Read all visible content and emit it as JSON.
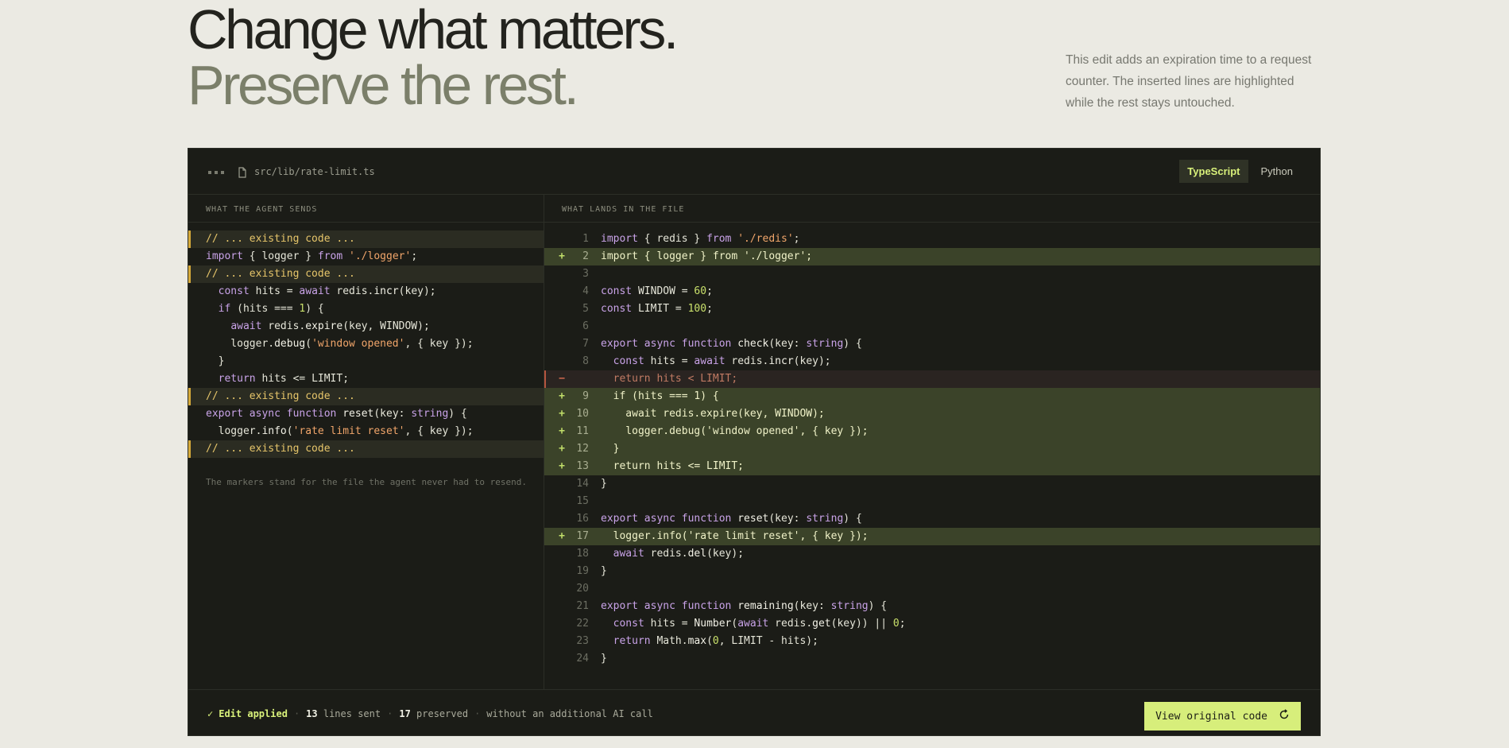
{
  "hero": {
    "headline_line1": "Change what matters.",
    "headline_line2": "Preserve the rest.",
    "description": "This edit adds an expiration time to a request counter. The inserted lines are highlighted while the rest stays untouched."
  },
  "editor": {
    "file_path": "src/lib/rate-limit.ts",
    "window_dots_icon": "more-dots-icon",
    "file_icon": "file-icon",
    "tabs": [
      {
        "label": "TypeScript",
        "active": true
      },
      {
        "label": "Python",
        "active": false
      }
    ],
    "left": {
      "header": "WHAT THE AGENT SENDS",
      "note": "The markers stand for the file the agent never had to resend."
    },
    "right": {
      "header": "WHAT LANDS IN THE FILE"
    },
    "footer": {
      "check_icon": "check-icon",
      "status": "Edit applied",
      "lines_sent_count": "13",
      "lines_sent_label": "lines sent",
      "preserved_count": "17",
      "preserved_label": "preserved",
      "tail": "without an additional AI call",
      "view_original_label": "View original code",
      "reset_icon": "refresh-icon"
    }
  },
  "colors": {
    "accent": "#d7ee7b",
    "added_bg": "#3b4329",
    "marker": "#d5a93a",
    "removed": "#b5553f"
  }
}
